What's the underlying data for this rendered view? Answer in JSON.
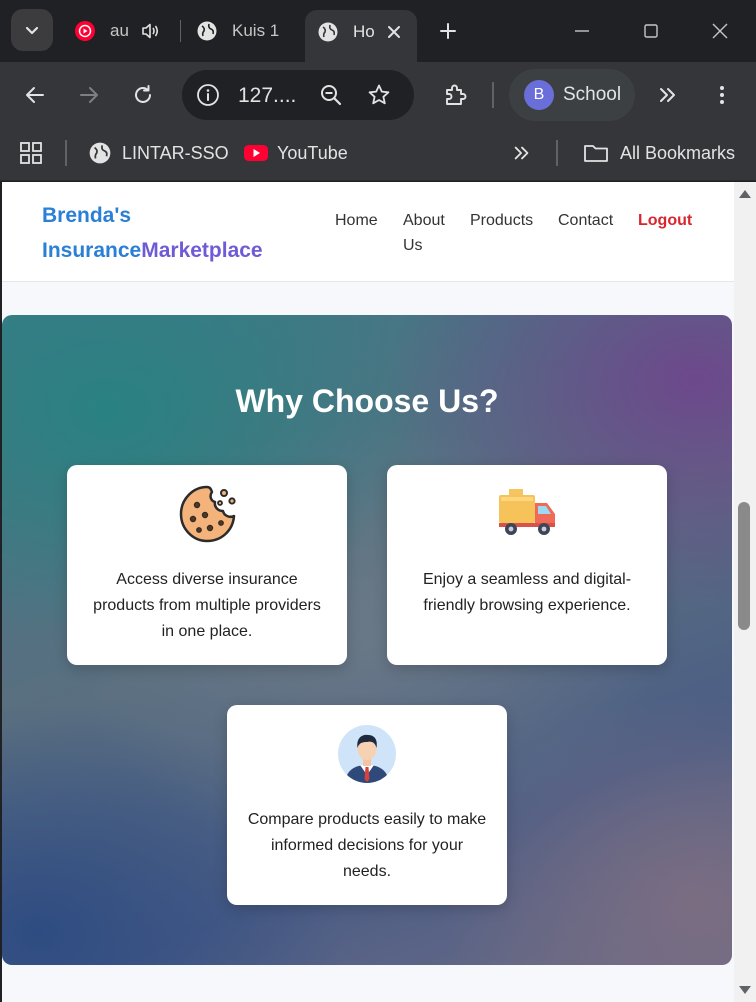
{
  "browser": {
    "tabs": [
      {
        "title": "au",
        "has_audio": true
      },
      {
        "title": "Kuis 1"
      },
      {
        "title": "Ho",
        "active": true
      }
    ],
    "url": "127....",
    "profile": {
      "initial": "B",
      "name": "School"
    },
    "bookmarks": [
      {
        "label": "LINTAR-SSO",
        "icon": "globe-icon"
      },
      {
        "label": "YouTube",
        "icon": "youtube-icon"
      }
    ],
    "all_bookmarks_label": "All Bookmarks"
  },
  "site": {
    "logo": {
      "part1": "Brenda's",
      "part2": "Insurance",
      "part3": "Marketplace"
    },
    "nav": {
      "home": "Home",
      "about_line1": "About",
      "about_line2": "Us",
      "products": "Products",
      "contact": "Contact",
      "logout": "Logout"
    },
    "why": {
      "title": "Why Choose Us?",
      "cards": [
        {
          "icon": "cookie-icon",
          "text": "Access diverse insurance products from multiple providers in one place."
        },
        {
          "icon": "delivery-truck-icon",
          "text": "Enjoy a seamless and digital-friendly browsing experience."
        },
        {
          "icon": "businessman-avatar-icon",
          "text": "Compare products easily to make informed decisions for your needs."
        }
      ]
    }
  },
  "colors": {
    "logo_blue": "#2a7fd6",
    "logo_purple": "#6f5bd6",
    "logout_red": "#d8262e",
    "browser_dark": "#202124",
    "toolbar": "#35363a"
  }
}
